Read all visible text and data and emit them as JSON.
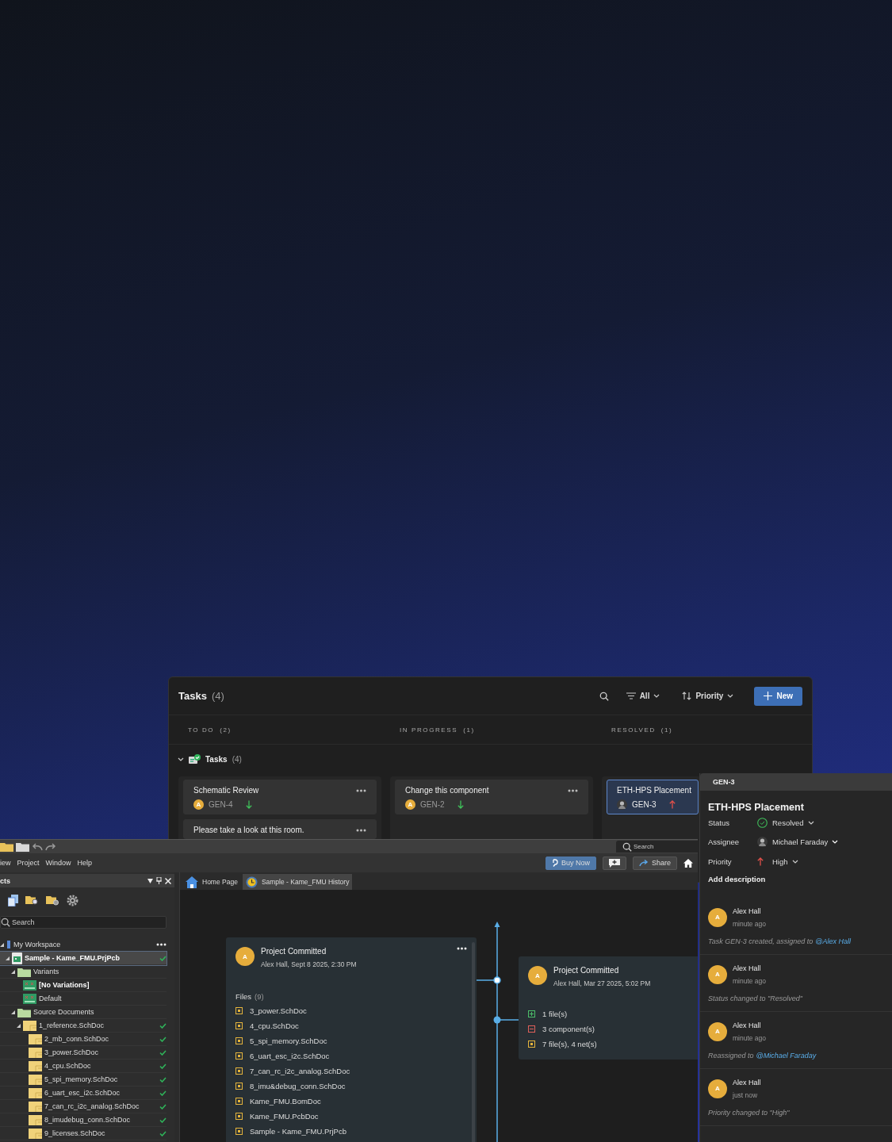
{
  "tasks_board": {
    "title": "Tasks",
    "count": "(4)",
    "filter": "All",
    "sort": "Priority",
    "new_button": "New",
    "group": {
      "label": "Tasks",
      "count": "(4)",
      "expanded": true
    },
    "columns": [
      {
        "label": "TO DO",
        "count": "(2)",
        "cards": [
          {
            "title": "Schematic Review",
            "avatar": {
              "kind": "initial",
              "text": "A"
            },
            "key": "GEN-4",
            "high_priority": false,
            "more_menu": true,
            "selected": false
          },
          {
            "title": "Please take a look at this room.",
            "more_menu": true,
            "selected": false
          }
        ]
      },
      {
        "label": "IN PROGRESS",
        "count": "(1)",
        "cards": [
          {
            "title": "Change this component",
            "avatar": {
              "kind": "initial",
              "text": "A"
            },
            "key": "GEN-2",
            "high_priority": false,
            "more_menu": true,
            "selected": false
          }
        ]
      },
      {
        "label": "RESOLVED",
        "count": "(1)",
        "cards": [
          {
            "title": "ETH-HPS Placement",
            "avatar": {
              "kind": "photo"
            },
            "key": "GEN-3",
            "high_priority": true,
            "more_menu": false,
            "selected": true
          }
        ]
      }
    ]
  },
  "ide": {
    "toolbar_search": {
      "placeholder": "Search"
    },
    "menu": [
      "iew",
      "Project",
      "Window",
      "Help"
    ],
    "buy_button": "Buy Now",
    "share_button": "Share",
    "tabs": [
      {
        "label": "Home Page",
        "kind": "home",
        "selected": false
      },
      {
        "label": "Sample - Kame_FMU History",
        "kind": "history",
        "selected": true
      }
    ],
    "projects_panel": {
      "title": "cts",
      "search": {
        "placeholder": "Search"
      },
      "tree": [
        {
          "label": "My Workspace",
          "kind": "workspace",
          "selected": false,
          "current": false,
          "checked": false,
          "expanded": true,
          "children": [
            {
              "label": "Sample - Kame_FMU.PrjPcb",
              "kind": "project",
              "selected": true,
              "current": true,
              "checked": true,
              "expanded": true,
              "children": [
                {
                  "label": "Variants",
                  "kind": "folder",
                  "selected": false,
                  "current": false,
                  "checked": false,
                  "expanded": true,
                  "children": [
                    {
                      "label": "[No Variations]",
                      "kind": "variant",
                      "selected": false,
                      "current": true,
                      "checked": false
                    },
                    {
                      "label": "Default",
                      "kind": "variant",
                      "selected": false,
                      "current": false,
                      "checked": false
                    }
                  ]
                },
                {
                  "label": "Source Documents",
                  "kind": "folder",
                  "selected": false,
                  "current": false,
                  "checked": false,
                  "expanded": true,
                  "children": [
                    {
                      "label": "1_reference.SchDoc",
                      "kind": "schematic",
                      "selected": false,
                      "current": false,
                      "checked": true,
                      "expanded": true,
                      "children": [
                        {
                          "label": "2_mb_conn.SchDoc",
                          "kind": "schematic",
                          "selected": false,
                          "current": false,
                          "checked": true
                        },
                        {
                          "label": "3_power.SchDoc",
                          "kind": "schematic",
                          "selected": false,
                          "current": false,
                          "checked": true
                        },
                        {
                          "label": "4_cpu.SchDoc",
                          "kind": "schematic",
                          "selected": false,
                          "current": false,
                          "checked": true
                        },
                        {
                          "label": "5_spi_memory.SchDoc",
                          "kind": "schematic",
                          "selected": false,
                          "current": false,
                          "checked": true
                        },
                        {
                          "label": "6_uart_esc_i2c.SchDoc",
                          "kind": "schematic",
                          "selected": false,
                          "current": false,
                          "checked": true
                        },
                        {
                          "label": "7_can_rc_i2c_analog.SchDoc",
                          "kind": "schematic",
                          "selected": false,
                          "current": false,
                          "checked": true
                        },
                        {
                          "label": "8_imudebug_conn.SchDoc",
                          "kind": "schematic",
                          "selected": false,
                          "current": false,
                          "checked": true
                        },
                        {
                          "label": "9_licenses.SchDoc",
                          "kind": "schematic",
                          "selected": false,
                          "current": false,
                          "checked": true
                        }
                      ]
                    }
                  ]
                }
              ]
            }
          ]
        }
      ]
    },
    "history": {
      "commits": [
        {
          "title": "Project Committed",
          "meta": "Alex Hall, Sept 8 2025, 2:30 PM",
          "avatar": "A",
          "files_label": "Files",
          "files_count": "(9)",
          "files": [
            "3_power.SchDoc",
            "4_cpu.SchDoc",
            "5_spi_memory.SchDoc",
            "6_uart_esc_i2c.SchDoc",
            "7_can_rc_i2c_analog.SchDoc",
            "8_imu&debug_conn.SchDoc",
            "Kame_FMU.BomDoc",
            "Kame_FMU.PcbDoc",
            "Sample - Kame_FMU.PrjPcb"
          ]
        },
        {
          "title": "Project Committed",
          "meta": "Alex Hall, Mar 27 2025, 5:02 PM",
          "avatar": "A",
          "changes": [
            {
              "kind": "added",
              "text": "1 file(s)"
            },
            {
              "kind": "removed",
              "text": "3 component(s)"
            },
            {
              "kind": "modified",
              "text": "7 file(s), 4 net(s)"
            }
          ]
        }
      ]
    }
  },
  "task_detail": {
    "tab": "GEN-3",
    "title": "ETH-HPS Placement",
    "fields": [
      {
        "label": "Status",
        "kind": "status",
        "value": "Resolved"
      },
      {
        "label": "Assignee",
        "kind": "assignee",
        "value": "Michael Faraday"
      },
      {
        "label": "Priority",
        "kind": "priority",
        "value": "High"
      }
    ],
    "add_description": "Add description",
    "activity": [
      {
        "author": "Alex Hall",
        "avatar": "A",
        "time": "minute ago",
        "text": "Task GEN-3 created, assigned to",
        "mention": "@Alex Hall"
      },
      {
        "author": "Alex Hall",
        "avatar": "A",
        "time": "minute ago",
        "text": "Status changed to \"Resolved\""
      },
      {
        "author": "Alex Hall",
        "avatar": "A",
        "time": "minute ago",
        "text": "Reassigned to",
        "mention": "@Michael Faraday"
      },
      {
        "author": "Alex Hall",
        "avatar": "A",
        "time": "just now",
        "text": "Priority changed to \"High\""
      }
    ]
  }
}
